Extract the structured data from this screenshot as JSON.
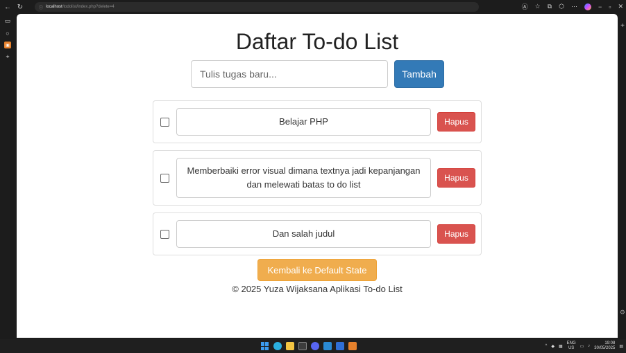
{
  "browser": {
    "address": {
      "host": "localhost",
      "path": "/todolist/index.php?delete=4"
    }
  },
  "page": {
    "title": "Daftar To-do List",
    "input_placeholder": "Tulis tugas baru...",
    "add_label": "Tambah",
    "delete_label": "Hapus",
    "reset_label": "Kembali ke Default State",
    "footer": "© 2025 Yuza Wijaksana Aplikasi To-do List"
  },
  "todos": [
    {
      "text": "Belajar PHP"
    },
    {
      "text": "Memberbaiki error visual dimana textnya jadi kepanjangan dan melewati batas to do list"
    },
    {
      "text": "Dan salah judul"
    }
  ],
  "taskbar": {
    "lang": "ENG",
    "region": "US",
    "time": "19:08",
    "date": "30/05/2025"
  },
  "colors": {
    "primary": "#337ab7",
    "danger": "#d9534f",
    "warning": "#f0ad4e"
  }
}
